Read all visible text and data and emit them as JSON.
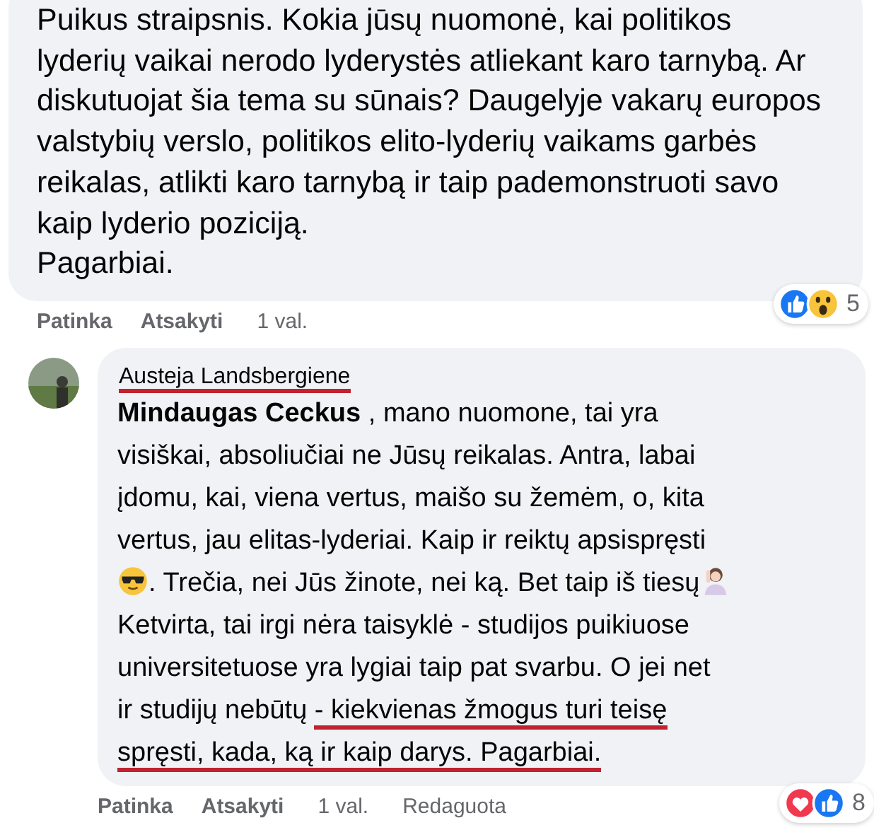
{
  "comments": [
    {
      "lines": [
        {
          "kind": "plain",
          "segments": [
            {
              "text": "Puikus straipsnis. Kokia jūsų nuomonė, kai politikos",
              "underlined": false
            }
          ]
        },
        {
          "kind": "plain",
          "segments": [
            {
              "text": "lyderių vaikai nerodo lyderystės atliekant karo tarnybą. Ar",
              "underlined": false
            }
          ]
        },
        {
          "kind": "plain",
          "segments": [
            {
              "text": "diskutuojat šia tema su sūnais? Daugelyje vakarų europos",
              "underlined": false
            }
          ]
        },
        {
          "kind": "plain",
          "segments": [
            {
              "text": "valstybių verslo, politikos elito-lyderių vaikams garbės",
              "underlined": false
            }
          ]
        },
        {
          "kind": "plain",
          "segments": [
            {
              "text": "reikalas, atlikti karo tarnybą ir taip pademonstruoti savo",
              "underlined": false
            }
          ]
        },
        {
          "kind": "plain",
          "segments": [
            {
              "text": "kaip lyderio poziciją.",
              "underlined": false
            }
          ]
        },
        {
          "kind": "plain",
          "segments": [
            {
              "text": "Pagarbiai.",
              "underlined": false
            }
          ]
        }
      ],
      "reactions": {
        "icons": [
          {
            "kind": "like"
          },
          {
            "kind": "wow"
          }
        ],
        "count": "5"
      },
      "actions": [
        {
          "label": "Patinka",
          "kind": "link"
        },
        {
          "label": "Atsakyti",
          "kind": "link"
        },
        {
          "label": "1 val.",
          "kind": "time"
        }
      ]
    },
    {
      "author": {
        "name": "Austeja Landsbergiene",
        "underlined": true
      },
      "mention": "Mindaugas Ceckus",
      "lines": [
        {
          "kind": "mention",
          "segments": [
            {
              "text": " , mano nuomone, tai yra",
              "underlined": false
            }
          ]
        },
        {
          "kind": "plain",
          "segments": [
            {
              "text": "visiškai, absoliučiai ne Jūsų reikalas. Antra, labai",
              "underlined": false
            }
          ]
        },
        {
          "kind": "plain",
          "segments": [
            {
              "text": "įdomu, kai, viena vertus, maišo su žemėm, o, kita",
              "underlined": false
            }
          ]
        },
        {
          "kind": "plain",
          "segments": [
            {
              "text": "vertus, jau elitas-lyderiai. Kaip ir reiktų apsispręsti",
              "underlined": false
            }
          ]
        },
        {
          "kind": "emoji-both",
          "segments": [
            {
              "text": ". Trečia, nei Jūs žinote, nei ką. Bet taip iš tiesų",
              "underlined": false
            }
          ]
        },
        {
          "kind": "plain",
          "segments": [
            {
              "text": "Ketvirta, tai irgi nėra taisyklė - studijos puikiuose",
              "underlined": false
            }
          ]
        },
        {
          "kind": "plain",
          "segments": [
            {
              "text": "universitetuose yra lygiai taip pat svarbu. O jei net",
              "underlined": false
            }
          ]
        },
        {
          "kind": "plain",
          "segments": [
            {
              "text": "ir studijų nebūtų ",
              "underlined": false
            },
            {
              "text": "- kiekvienas žmogus turi teisę",
              "underlined": true
            }
          ]
        },
        {
          "kind": "plain",
          "segments": [
            {
              "text": "spręsti, kada, ką ir kaip darys. Pagarbiai.",
              "underlined": true
            }
          ]
        }
      ],
      "reactions": {
        "icons": [
          {
            "kind": "love"
          },
          {
            "kind": "like"
          }
        ],
        "count": "8"
      },
      "actions": [
        {
          "label": "Patinka",
          "kind": "link"
        },
        {
          "label": "Atsakyti",
          "kind": "link"
        },
        {
          "label": "1 val.",
          "kind": "time"
        },
        {
          "label": "Redaguota",
          "kind": "time"
        }
      ]
    }
  ]
}
